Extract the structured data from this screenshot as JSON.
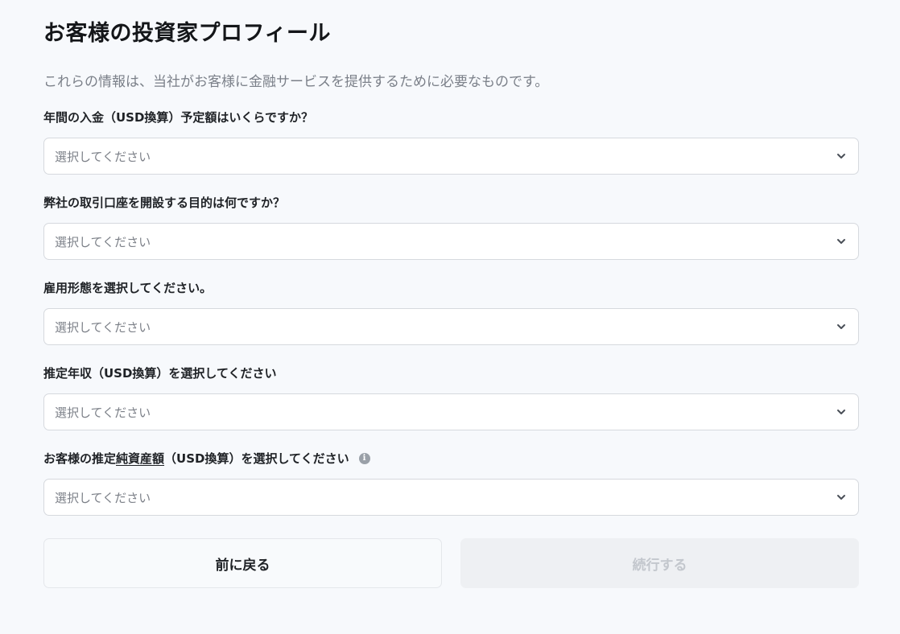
{
  "header": {
    "title": "お客様の投資家プロフィール",
    "subtitle": "これらの情報は、当社がお客様に金融サービスを提供するために必要なものです。"
  },
  "fields": [
    {
      "label": "年間の入金（USD換算）予定額はいくらですか？",
      "value": "選択してください"
    },
    {
      "label": "弊社の取引口座を開設する目的は何ですか？",
      "value": "選択してください"
    },
    {
      "label": "雇用形態を選択してください。",
      "value": "選択してください"
    },
    {
      "label": "推定年収（USD換算）を選択してください",
      "value": "選択してください"
    },
    {
      "label_prefix": "お客様の推定",
      "label_underlined": "純資産額",
      "label_suffix": "（USD換算）を選択してください",
      "info_icon": "info-icon",
      "info_glyph": "i",
      "value": "選択してください"
    }
  ],
  "icons": {
    "select_chevron": "chevron-down-icon"
  },
  "buttons": {
    "back_label": "前に戻る",
    "continue_label": "続行する",
    "continue_disabled": true
  },
  "colors": {
    "background": "#f7f9fc",
    "disabled_button_bg": "#eef0f3",
    "disabled_button_text": "#c3c7cd"
  }
}
